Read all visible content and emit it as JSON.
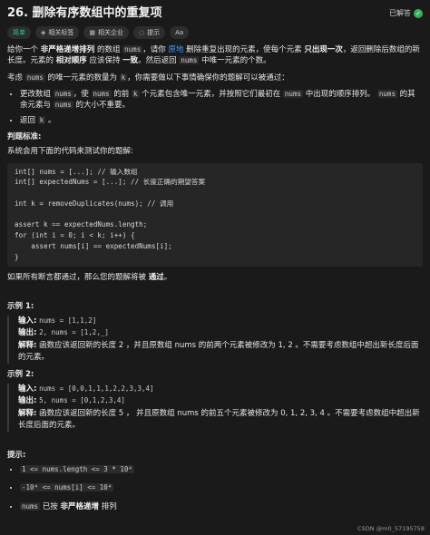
{
  "header": {
    "title": "26. 删除有序数组中的重复项",
    "status": "已解答"
  },
  "tags": [
    {
      "label": "简单",
      "icon": "none"
    },
    {
      "label": "相关标签",
      "icon": "tag-icon"
    },
    {
      "label": "相关企业",
      "icon": "building-icon"
    },
    {
      "label": "提示",
      "icon": "bulb-icon"
    },
    {
      "label": "Aa",
      "icon": "font-icon"
    }
  ],
  "colors": {
    "accent": "#3c9dff",
    "easy": "#24c9a3",
    "solved": "#2db55d"
  },
  "description": {
    "p1_a": "给你一个",
    "p1_b": "非严格递增排列",
    "p1_c": "的数组",
    "p1_code1": "nums",
    "p1_d": "，请你",
    "p1_link": "原地",
    "p1_e": "删除重复出现的元素，使每个元素",
    "p1_f": "只出现一次",
    "p1_g": "，返回删除后数组的新长度。元素的",
    "p1_h": "相对顺序",
    "p1_i": "应该保持",
    "p1_j": "一致",
    "p1_k": "。然后返回",
    "p1_code2": "nums",
    "p1_l": "中唯一元素的个数。",
    "p2_a": "考虑",
    "p2_code1": "nums",
    "p2_b": "的唯一元素的数量为",
    "p2_code2": "k",
    "p2_c": "，你需要做以下事情确保你的题解可以被通过：",
    "li1_a": "更改数组",
    "li1_code1": "nums",
    "li1_b": "，使",
    "li1_code2": "nums",
    "li1_c": "的前",
    "li1_code3": "k",
    "li1_d": "个元素包含唯一元素，并按照它们最初在",
    "li1_code4": "nums",
    "li1_e": "中出现的顺序排列。",
    "li1_code5": "nums",
    "li1_f": "的其余元素与",
    "li1_code6": "nums",
    "li1_g": "的大小不重要。",
    "li2_a": "返回",
    "li2_code": "k",
    "li2_b": "。"
  },
  "judge": {
    "label": "判题标准:",
    "intro": "系统会用下面的代码来测试你的题解:",
    "code": "int[] nums = [...]; // 输入数组\nint[] expectedNums = [...]; // 长度正确的期望答案\n\nint k = removeDuplicates(nums); // 调用\n\nassert k == expectedNums.length;\nfor (int i = 0; i < k; i++) {\n    assert nums[i] == expectedNums[i];\n}",
    "outro_a": "如果所有断言都通过，那么您的题解将被",
    "outro_b": "通过",
    "outro_c": "。"
  },
  "example1": {
    "label": "示例 1:",
    "input_label": "输入:",
    "input": "nums = [1,1,2]",
    "output_label": "输出:",
    "output": "2, nums = [1,2,_]",
    "explain_label": "解释:",
    "explain": "函数应该返回新的长度 2 ，并且原数组 nums 的前两个元素被修改为 1, 2 。不需要考虑数组中超出新长度后面的元素。"
  },
  "example2": {
    "label": "示例 2:",
    "input_label": "输入:",
    "input": "nums = [0,0,1,1,1,2,2,3,3,4]",
    "output_label": "输出:",
    "output": "5, nums = [0,1,2,3,4]",
    "explain_label": "解释:",
    "explain": "函数应该返回新的长度 5 ， 并且原数组 nums 的前五个元素被修改为 0, 1, 2, 3, 4 。不需要考虑数组中超出新长度后面的元素。"
  },
  "constraints": {
    "label": "提示:",
    "c1": "1 <= nums.length <= 3 * 10⁴",
    "c2": "-10⁴ <= nums[i] <= 10⁴",
    "c3_code": "nums",
    "c3_a": "已按",
    "c3_b": "非严格递增",
    "c3_c": "排列"
  },
  "watermark": "CSDN @m0_57195758"
}
